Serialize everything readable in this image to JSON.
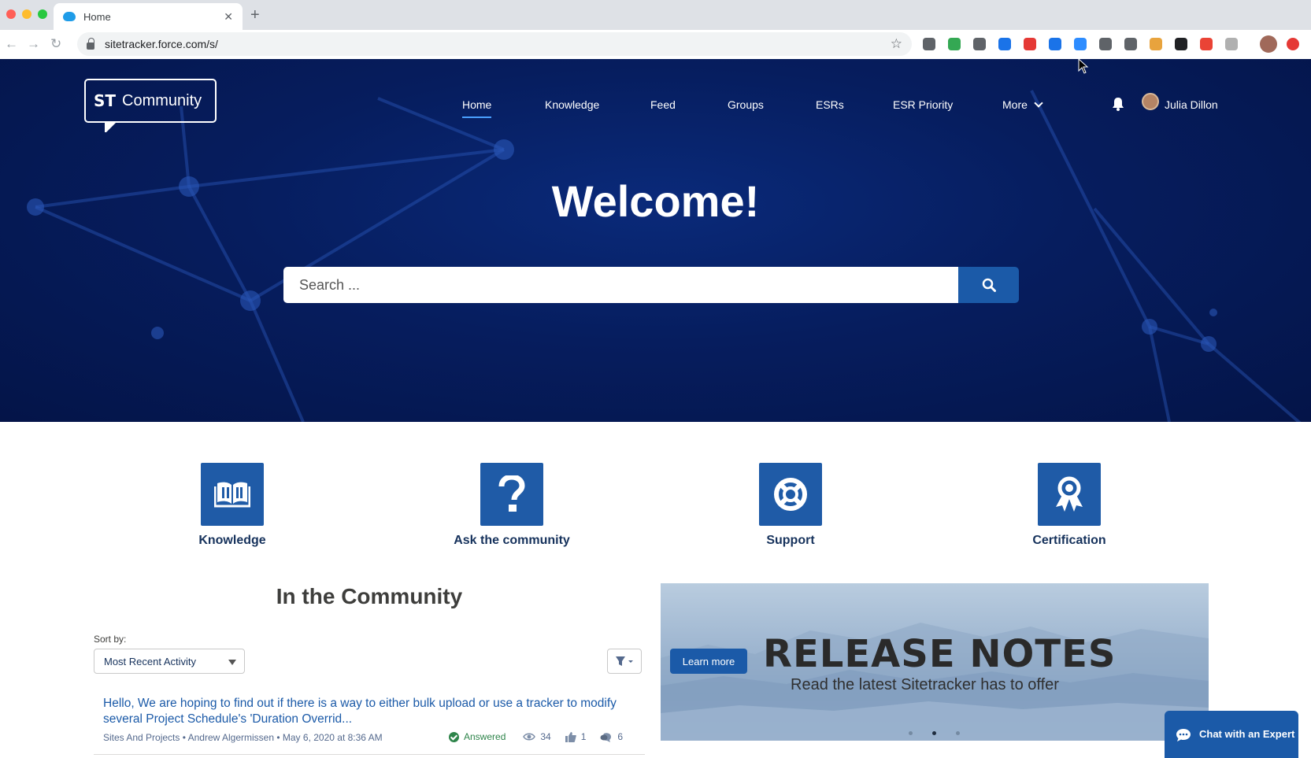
{
  "browser": {
    "tab_title": "Home",
    "tab_close": "✕",
    "new_tab": "+",
    "url": "sitetracker.force.com/s/",
    "back": "←",
    "forward": "→",
    "reload": "↻",
    "bookmark_star": "☆",
    "extension_colors": [
      "#5f6368",
      "#34a853",
      "#5f6368",
      "#1a73e8",
      "#e53935",
      "#1a73e8",
      "#2d8cff",
      "#5f6368",
      "#5f6368",
      "#e8a33d",
      "#202124",
      "#ea4335",
      "#b0b0b0"
    ]
  },
  "header": {
    "logo_mark": "ST",
    "logo_text": "Community",
    "nav": [
      {
        "label": "Home",
        "active": true
      },
      {
        "label": "Knowledge"
      },
      {
        "label": "Feed"
      },
      {
        "label": "Groups"
      },
      {
        "label": "ESRs"
      },
      {
        "label": "ESR Priority"
      },
      {
        "label": "More"
      }
    ],
    "user_name": "Julia Dillon"
  },
  "hero": {
    "welcome": "Welcome!",
    "search_placeholder": "Search ..."
  },
  "tiles": [
    {
      "label": "Knowledge",
      "icon": "book-icon"
    },
    {
      "label": "Ask the community",
      "icon": "question-icon"
    },
    {
      "label": "Support",
      "icon": "lifebuoy-icon"
    },
    {
      "label": "Certification",
      "icon": "award-ribbon-icon"
    }
  ],
  "community": {
    "title": "In the Community",
    "sort_label": "Sort by:",
    "sort_value": "Most Recent Activity",
    "post": {
      "title": "Hello, We are hoping to find out if there is a way to either bulk upload or use a tracker to modify several Project Schedule's 'Duration Overrid...",
      "topic": "Sites And Projects",
      "author": "Andrew Algermissen",
      "date": "May 6, 2020 at 8:36 AM",
      "separator": "•",
      "status": "Answered",
      "views": "34",
      "likes": "1",
      "comments": "6"
    }
  },
  "banner": {
    "button": "Learn more",
    "title": "RELEASE NOTES",
    "subtitle": "Read the latest Sitetracker has to offer",
    "active_slide": 2,
    "slide_count": 3
  },
  "chat": {
    "label": "Chat with an Expert"
  },
  "colors": {
    "brand_blue": "#1b5aa8",
    "tile_blue": "#1f5ba7",
    "hero_navy": "#061d5e",
    "answered_green": "#2e844a"
  }
}
